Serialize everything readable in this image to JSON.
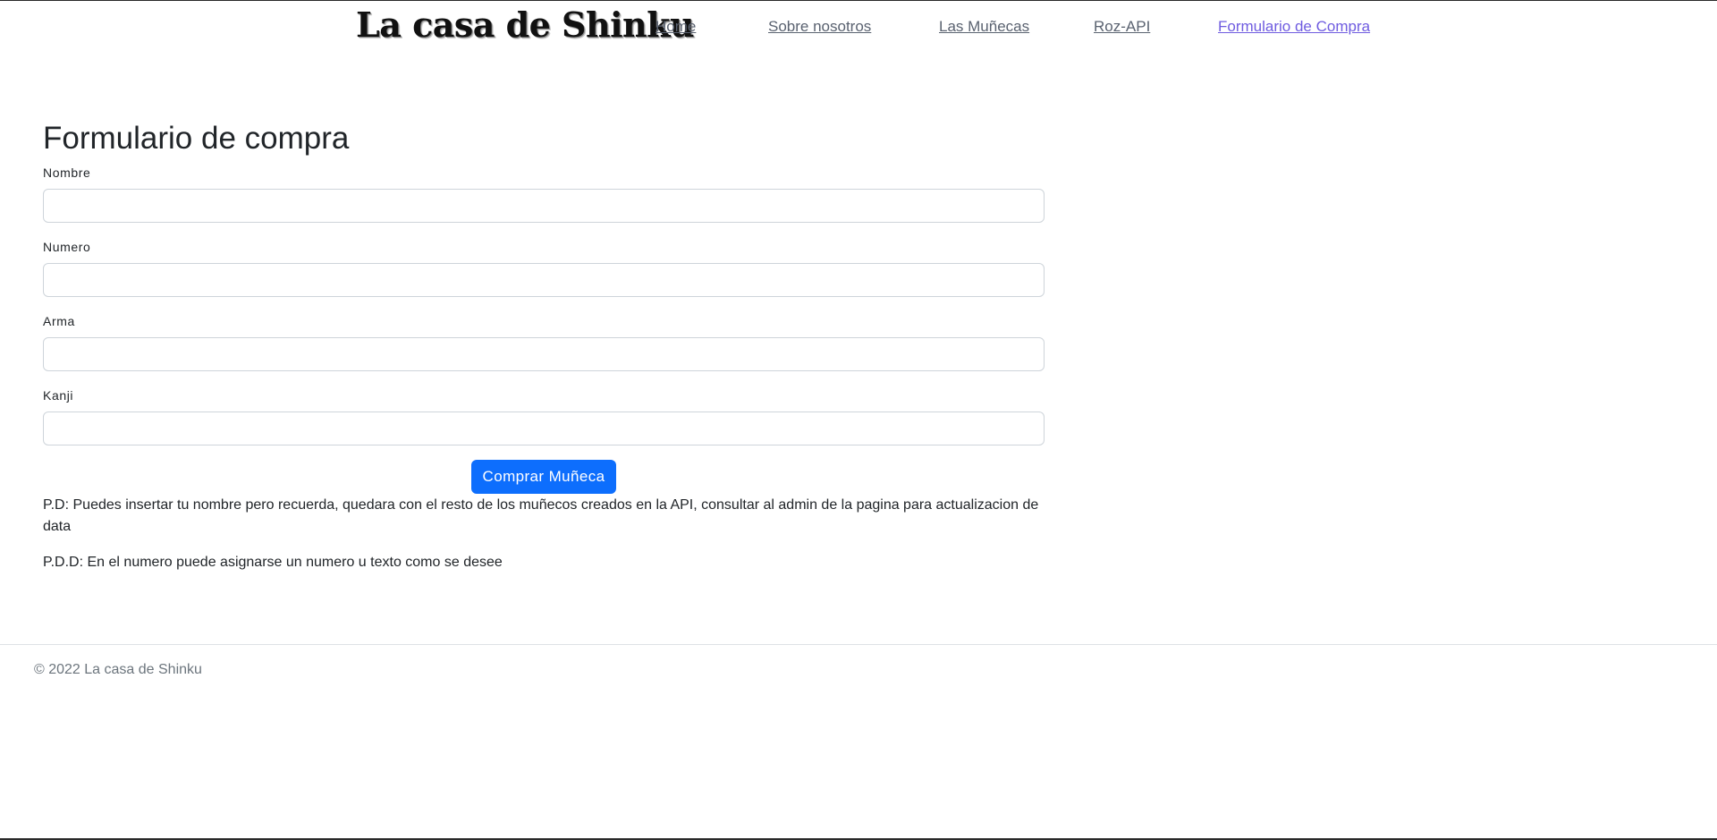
{
  "header": {
    "brand": "La casa de Shinku",
    "nav": [
      {
        "label": "Home",
        "active": false
      },
      {
        "label": "Sobre nosotros",
        "active": false
      },
      {
        "label": "Las Muñecas",
        "active": false
      },
      {
        "label": "Roz-API",
        "active": false
      },
      {
        "label": "Formulario de Compra",
        "active": true
      }
    ]
  },
  "form": {
    "title": "Formulario de compra",
    "fields": [
      {
        "label": "Nombre",
        "value": "",
        "placeholder": ""
      },
      {
        "label": "Numero",
        "value": "",
        "placeholder": ""
      },
      {
        "label": "Arma",
        "value": "",
        "placeholder": ""
      },
      {
        "label": "Kanji",
        "value": "",
        "placeholder": ""
      }
    ],
    "submit_label": "Comprar Muñeca",
    "notes": [
      "P.D: Puedes insertar tu nombre pero recuerda, quedara con el resto de los muñecos creados en la API, consultar al admin de la pagina para actualizacion de data",
      "P.D.D: En el numero puede asignarse un numero u texto como se desee"
    ]
  },
  "footer": {
    "text": "© 2022 La casa de Shinku"
  },
  "colors": {
    "primary": "#0d6efd",
    "active_link": "#6f5ce0",
    "nav_link": "#5a6270",
    "muted": "#6c757d"
  }
}
